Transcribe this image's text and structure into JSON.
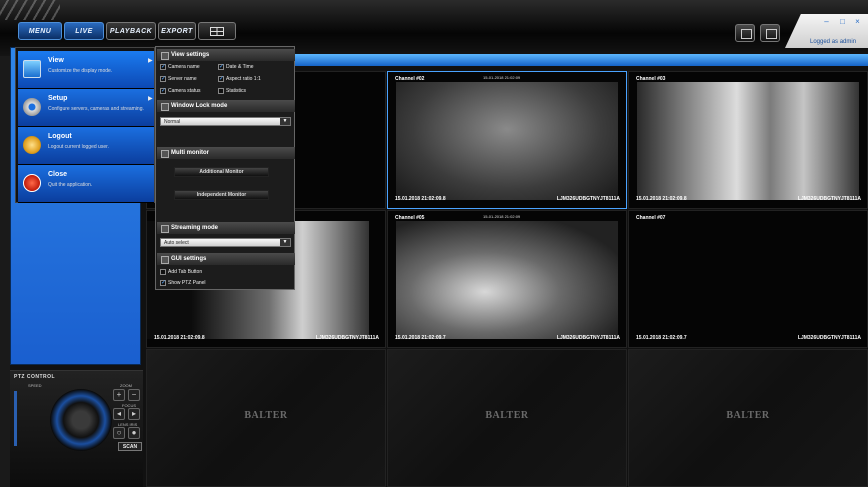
{
  "nav": {
    "menu": "MENU",
    "live": "LIVE",
    "playback": "PLAYBACK",
    "export": "EXPORT"
  },
  "user": {
    "logged_as": "Logged as admin"
  },
  "window_controls": {
    "minimize": "–",
    "maximize": "□",
    "close": "×"
  },
  "main_menu": [
    {
      "title": "View",
      "desc": "Customize the display mode.",
      "icon": "monitor-icon"
    },
    {
      "title": "Setup",
      "desc": "Configure servers, cameras and streaming.",
      "icon": "gear-icon"
    },
    {
      "title": "Logout",
      "desc": "Logout current logged user.",
      "icon": "key-icon"
    },
    {
      "title": "Close",
      "desc": "Quit the application.",
      "icon": "power-icon"
    }
  ],
  "view_menu": {
    "view_settings": "View settings",
    "options": {
      "camera_name": "Camera name",
      "date_time": "Date & Time",
      "server_name": "Server name",
      "aspect_ratio": "Aspect ratio 1:1",
      "camera_status": "Camera status",
      "statistics": "Statistics"
    },
    "window_lock": "Window Lock mode",
    "window_lock_value": "Normal",
    "multi_monitor": "Multi monitor",
    "additional_monitor": "Additional Monitor",
    "independent_monitor": "Independent Monitor",
    "streaming_mode": "Streaming mode",
    "streaming_value": "Auto select",
    "gui_settings": "GUI settings",
    "add_tab_button": "Add Tab Button",
    "show_ptz_panel": "Show PTZ Panel"
  },
  "ptz": {
    "title": "PTZ CONTROL",
    "speed": "SPEED",
    "zoom": "ZOOM",
    "focus": "FOCUS",
    "lens": "LENS IRIS",
    "scan": "SCAN"
  },
  "cameras": [
    {
      "name": "",
      "timestamp": "",
      "id": ""
    },
    {
      "name": "Channel #02",
      "timestamp": "15.01.2018 21:02:09.8",
      "id": "LJM326UDBGTNYJT8111A",
      "overlay_ts": "15-01-2018 21:02:09"
    },
    {
      "name": "Channel #03",
      "timestamp": "15.01.2018 21:02:09.8",
      "id": "LJM326UDBGTNYJT8111A"
    },
    {
      "name": "",
      "timestamp": "15.01.2018 21:02:09.8",
      "id": "LJM326UDBGTNYJT8111A"
    },
    {
      "name": "Channel #05",
      "timestamp": "15.01.2018 21:02:09.7",
      "id": "LJM326UDBGTNYJT8111A",
      "overlay_ts": "15-01-2018 21:02:09"
    },
    {
      "name": "Channel #07",
      "timestamp": "15.01.2018 21:02:09.7",
      "id": "LJM326UDBGTNYJT8111A"
    }
  ],
  "empty_brand": "BALTER"
}
